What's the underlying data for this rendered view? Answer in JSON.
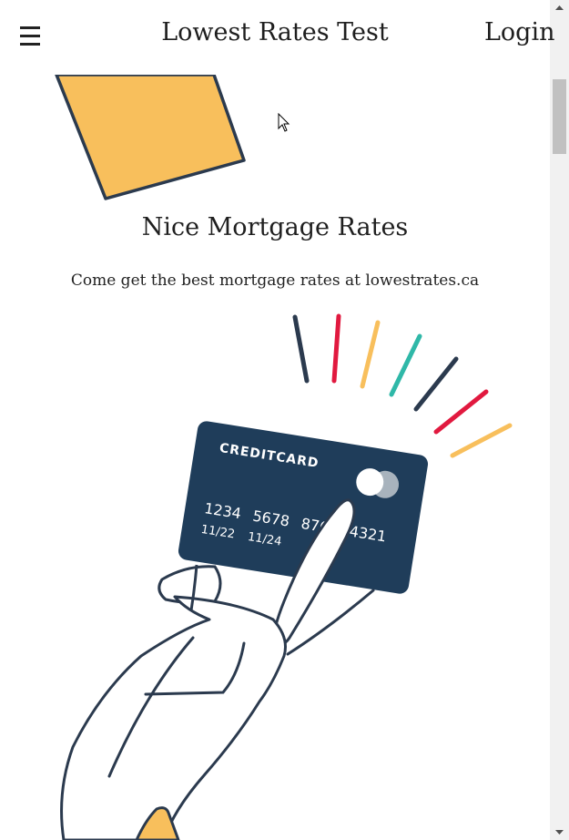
{
  "header": {
    "menu_icon": "hamburger-menu-icon",
    "title": "Lowest Rates Test",
    "login_label": "Login"
  },
  "main": {
    "heading": "Nice Mortgage Rates",
    "subtext": "Come get the best mortgage rates at lowestrates.ca"
  },
  "card": {
    "brand_text": "CREDITCARD",
    "number": "1234 5678 8765 4321",
    "expiry_1": "11/22",
    "expiry_2": "11/24"
  },
  "colors": {
    "accent_yellow": "#f8bf5c",
    "card_navy": "#1f3d5a",
    "stroke_dark": "#2b3a4e",
    "accent_red": "#e1193f",
    "accent_teal": "#2fb8a8"
  },
  "scrollbar": {
    "up_icon": "scroll-up-arrow-icon",
    "down_icon": "scroll-down-arrow-icon"
  }
}
